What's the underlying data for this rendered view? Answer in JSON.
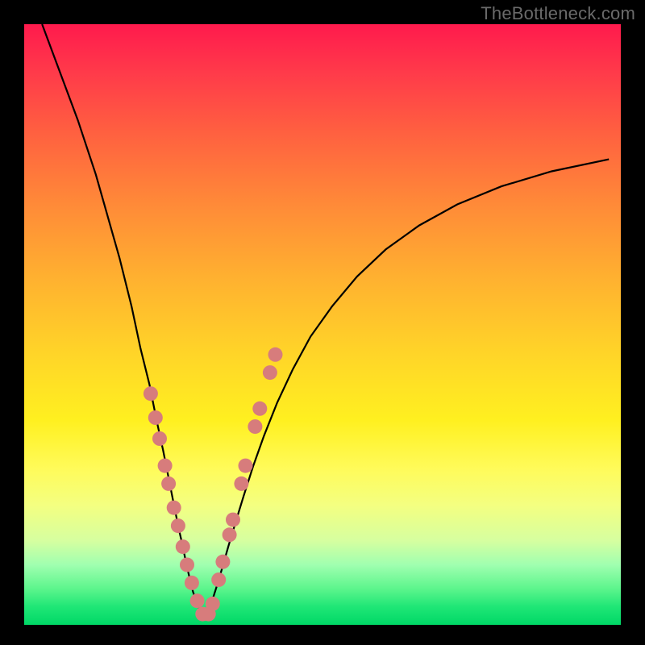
{
  "watermark": "TheBottleneck.com",
  "colors": {
    "frame": "#000000",
    "gradient_top": "#ff1a4d",
    "gradient_mid": "#ffe030",
    "gradient_bottom": "#00d866",
    "curve": "#000000",
    "dots": "#d77c7c"
  },
  "chart_data": {
    "type": "line",
    "title": "",
    "xlabel": "",
    "ylabel": "",
    "xlim": [
      0,
      100
    ],
    "ylim": [
      0,
      100
    ],
    "note": "No axes/ticks rendered; values are estimated from pixel positions on a 0–100 normalized grid (origin bottom-left). Background hue encodes y (red≈100 → green≈0).",
    "series": [
      {
        "name": "left-branch",
        "x": [
          3,
          6,
          9,
          12,
          14,
          16,
          18,
          19.5,
          21,
          22.2,
          23.3,
          24.3,
          25.1,
          25.9,
          26.6,
          27.2,
          27.8,
          28.3,
          28.8,
          29.3,
          29.8,
          30.2
        ],
        "y": [
          100,
          92,
          84,
          75,
          68,
          61,
          53,
          46,
          40,
          34,
          29,
          24,
          20,
          16,
          13,
          10,
          7.5,
          5.5,
          4,
          2.8,
          1.8,
          1
        ]
      },
      {
        "name": "right-branch",
        "x": [
          30.2,
          30.8,
          31.5,
          32.3,
          33.2,
          34.2,
          35.4,
          36.8,
          38.4,
          40.2,
          42.4,
          45,
          48,
          51.6,
          55.8,
          60.6,
          66.2,
          72.6,
          80,
          88.4,
          98
        ],
        "y": [
          1,
          2.2,
          4,
          6.5,
          9.5,
          13,
          17,
          21.5,
          26.5,
          31.5,
          37,
          42.5,
          48,
          53,
          58,
          62.5,
          66.5,
          70,
          73,
          75.5,
          77.5
        ]
      }
    ],
    "scatter_overlay": {
      "name": "highlight-dots",
      "x": [
        21.2,
        22.0,
        22.7,
        23.6,
        24.2,
        25.1,
        25.8,
        26.6,
        27.3,
        28.1,
        29.0,
        29.9,
        30.9,
        31.6,
        32.6,
        33.3,
        34.4,
        35.0,
        36.4,
        37.1,
        38.7,
        39.5,
        41.2,
        42.1
      ],
      "y": [
        38.5,
        34.5,
        31.0,
        26.5,
        23.5,
        19.5,
        16.5,
        13.0,
        10.0,
        7.0,
        4.0,
        1.8,
        1.8,
        3.5,
        7.5,
        10.5,
        15.0,
        17.5,
        23.5,
        26.5,
        33.0,
        36.0,
        42.0,
        45.0
      ]
    }
  }
}
